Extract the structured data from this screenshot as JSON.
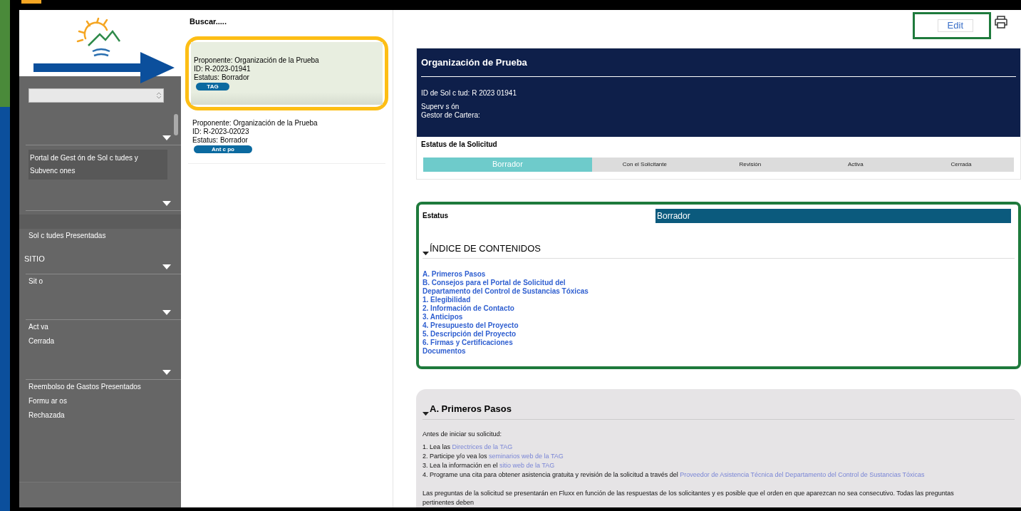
{
  "sidebar": {
    "items": [
      {
        "kind": "header"
      },
      {
        "kind": "highlighted",
        "label": "Portal de Gest ón de Sol c tudes y Subvenc ones"
      },
      {
        "kind": "header"
      },
      {
        "kind": "band"
      },
      {
        "kind": "item",
        "label": "Sol c tudes Presentadas"
      },
      {
        "kind": "header",
        "label": "SITIO"
      },
      {
        "kind": "item",
        "label": "Sit o"
      },
      {
        "kind": "header"
      },
      {
        "kind": "item",
        "label": "Act va"
      },
      {
        "kind": "item",
        "label": "Cerrada"
      },
      {
        "kind": "header"
      },
      {
        "kind": "item",
        "label": "Reembolso de Gastos Presentados"
      },
      {
        "kind": "item",
        "label": "Formu ar os"
      },
      {
        "kind": "item",
        "label": "Rechazada"
      }
    ]
  },
  "list": {
    "search": "Buscar.....",
    "cards": [
      {
        "selected": true,
        "proponent": "Proponente: Organización de la Prueba",
        "id": "ID: R-2023-01941",
        "status": "Estatus: Borrador",
        "tag": "TAG"
      },
      {
        "selected": false,
        "proponent": "Proponente: Organización de la Prueba",
        "id": "ID: R-2023-02023",
        "status": "Estatus: Borrador",
        "tag": "Ant c po"
      }
    ]
  },
  "toolbar": {
    "edit": "Edit"
  },
  "header": {
    "title": "Organización de Prueba",
    "lines": [
      "ID de Sol c tud: R 2023 01941",
      "Superv s ón",
      "Gestor de Cartera:"
    ],
    "status_title": "Estatus de la Solicitud",
    "steps": [
      {
        "label": "Borrador",
        "selected": true
      },
      {
        "label": "Con el Solicitante",
        "selected": false
      },
      {
        "label": "Revisión",
        "selected": false
      },
      {
        "label": "Activa",
        "selected": false
      },
      {
        "label": "Cerrada",
        "selected": false
      }
    ]
  },
  "status_card": {
    "label": "Estatus",
    "value": "Borrador",
    "toc_title": "ÍNDICE DE CONTENIDOS",
    "expanded": true,
    "toc": [
      "A. Primeros Pasos",
      "B. Consejos para el Portal de Solicitud del",
      "Departamento del Control de Sustancias Tóxicas",
      "1. Elegibilidad",
      "2. Información de Contacto",
      "3. Anticipos",
      "4. Presupuesto del Proyecto",
      "5. Descripción del Proyecto",
      "6. Firmas y Certificaciones",
      "Documentos"
    ]
  },
  "section": {
    "title": "A. Primeros Pasos",
    "expanded": true,
    "intro": "Antes de iniciar su solicitud:",
    "steps": [
      {
        "text": "1. Lea las ",
        "link": "Directrices de la TAG"
      },
      {
        "text": "2. Participe y/o vea los ",
        "link": "seminarios web de la TAG"
      },
      {
        "text": "3. Lea la información en el ",
        "link": "sitio web de la TAG"
      },
      {
        "text": "4. Programe una cita para obtener asistencia gratuita y revisión de la solicitud a través del ",
        "link": "Proveedor de Asistencia Técnica del Departamento del Control de Sustancias Tóxicas"
      }
    ],
    "paragraph": "Las preguntas de la solicitud se presentarán en Fluxx en función de las respuestas de los solicitantes y es posible que el orden en que aparezcan no sea consecutivo. Todas las preguntas pertinentes deben"
  }
}
